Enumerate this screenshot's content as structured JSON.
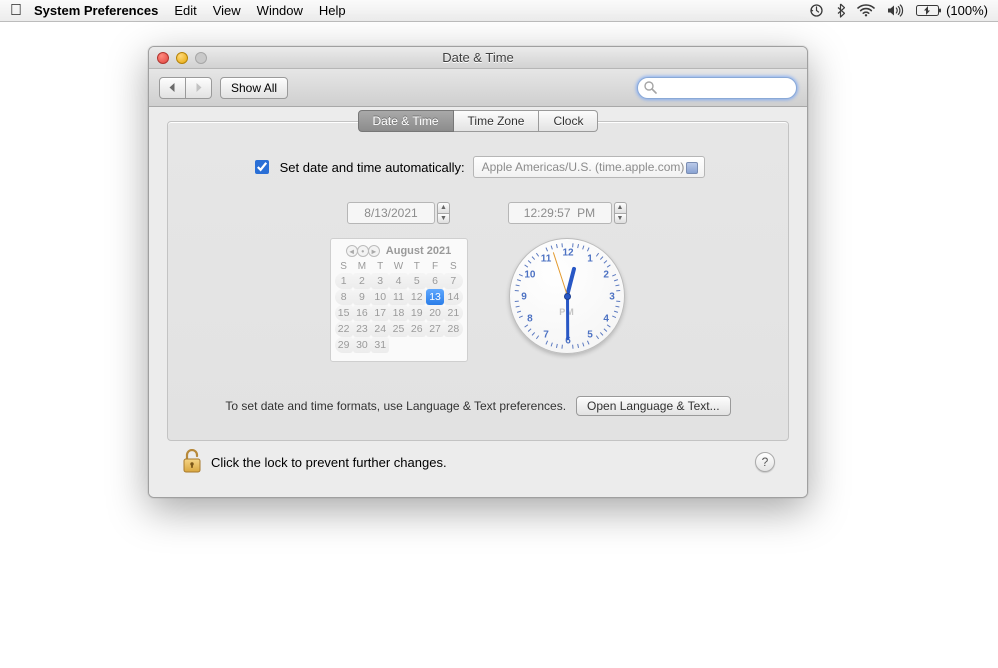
{
  "menubar": {
    "app": "System Preferences",
    "items": [
      "Edit",
      "View",
      "Window",
      "Help"
    ],
    "battery_text": "(100%)"
  },
  "window": {
    "title": "Date & Time",
    "show_all": "Show All",
    "search_placeholder": ""
  },
  "tabs": [
    "Date & Time",
    "Time Zone",
    "Clock"
  ],
  "tab_selected": 0,
  "auto": {
    "checked": true,
    "label": "Set date and time automatically:",
    "server": "Apple Americas/U.S. (time.apple.com)"
  },
  "date_field": "8/13/2021",
  "time_field": "12:29:57  PM",
  "calendar": {
    "month_label": "August 2021",
    "dow": [
      "S",
      "M",
      "T",
      "W",
      "T",
      "F",
      "S"
    ],
    "weeks": [
      [
        "1",
        "2",
        "3",
        "4",
        "5",
        "6",
        "7"
      ],
      [
        "8",
        "9",
        "10",
        "11",
        "12",
        "13",
        "14"
      ],
      [
        "15",
        "16",
        "17",
        "18",
        "19",
        "20",
        "21"
      ],
      [
        "22",
        "23",
        "24",
        "25",
        "26",
        "27",
        "28"
      ],
      [
        "29",
        "30",
        "31",
        "",
        "",
        "",
        ""
      ]
    ],
    "today": "13"
  },
  "clock": {
    "ampm": "PM",
    "hour": 12,
    "minute": 29,
    "second": 57
  },
  "hint_text": "To set date and time formats, use Language & Text preferences.",
  "open_lang_btn": "Open Language & Text...",
  "lock_text": "Click the lock to prevent further changes."
}
